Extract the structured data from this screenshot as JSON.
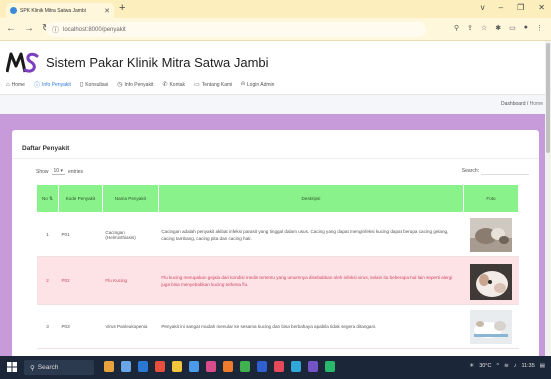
{
  "browser": {
    "tab_title": "SPK Klinik Mitra Satwa Jambi",
    "new_tab": "+",
    "url": "localhost:8000/penyakit",
    "window_controls": [
      "v",
      "–",
      "❐",
      "✕"
    ]
  },
  "header": {
    "logo_text": "MS",
    "title": "Sistem Pakar Klinik Mitra Satwa Jambi"
  },
  "menu": [
    {
      "label": "Home",
      "icon": "home-icon"
    },
    {
      "label": "Info Penyakit",
      "icon": "info-icon",
      "active": true
    },
    {
      "label": "Konsultasi",
      "icon": "document-icon"
    },
    {
      "label": "Info Penyakit",
      "icon": "clock-icon"
    },
    {
      "label": "Kontak",
      "icon": "phone-icon"
    },
    {
      "label": "Tentang Kami",
      "icon": "chat-icon"
    },
    {
      "label": "Login Admin",
      "icon": "user-icon"
    }
  ],
  "breadcrumb": {
    "current": "Dashboard",
    "separator": "/",
    "home": "Home"
  },
  "card": {
    "title": "Daftar Penyakit",
    "show_label": "Show",
    "entries_value": "10",
    "entries_label": "entries",
    "search_label": "Search:"
  },
  "table": {
    "headers": [
      "No",
      "Kode Penyakit",
      "Nama Penyakit",
      "Deskripsi",
      "Foto"
    ],
    "rows": [
      {
        "no": "1",
        "kode": "P01",
        "nama": "Cacingan (Helminthiasis)",
        "deskripsi": "Cacingan adalah penyakit akibat infeksi parasit yang tinggal dalam usus. Cacing yang dapat menginfeksi kucing dapat berupa cacing gelang, cacing tambang, cacing pita dan cacing hati."
      },
      {
        "no": "2",
        "kode": "P02",
        "nama": "Flu Kucing",
        "deskripsi": "Flu kucing merupakan gejala dari kondisi medis tertentu yang umumnya disebabkan oleh infeksi virus, selain itu beberapa hal lain seperti alergi juga bisa menyebabkan kucing terkena flu."
      },
      {
        "no": "3",
        "kode": "P03",
        "nama": "Virus Panleukopenia",
        "deskripsi": "Penyakit ini sangat mudah menular ke sesama kucing dan bisa berbahaya apabila tidak segera ditangani."
      }
    ]
  },
  "taskbar": {
    "search_label": "Search",
    "weather": "30°C",
    "time": "11:35"
  },
  "colors": {
    "purple_band": "#c79bd9",
    "table_header": "#8af28a",
    "highlight_row": "#fde2e6",
    "active_menu": "#2e7bd6"
  }
}
